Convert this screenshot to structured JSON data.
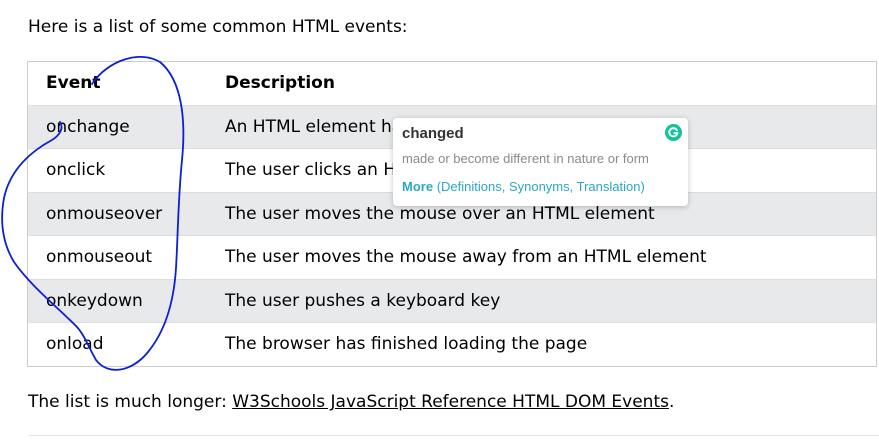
{
  "intro_text": "Here is a list of some common HTML events:",
  "table": {
    "headers": [
      "Event",
      "Description"
    ],
    "rows": [
      {
        "event": "onchange",
        "description": "An HTML element has been changed"
      },
      {
        "event": "onclick",
        "description": "The user clicks an HTML element"
      },
      {
        "event": "onmouseover",
        "description": "The user moves the mouse over an HTML element"
      },
      {
        "event": "onmouseout",
        "description": "The user moves the mouse away from an HTML element"
      },
      {
        "event": "onkeydown",
        "description": "The user pushes a keyboard key"
      },
      {
        "event": "onload",
        "description": "The browser has finished loading the page"
      }
    ]
  },
  "outro": {
    "prefix": "The list is much longer: ",
    "link_text": "W3Schools JavaScript Reference HTML DOM Events",
    "suffix": "."
  },
  "popup": {
    "word": "changed",
    "definition": "made or become different in nature or form",
    "more_label": "More",
    "more_links": "(Definitions, Synonyms, Translation)",
    "icon": "grammarly-icon",
    "icon_color": "#15c39a",
    "link_color": "#2aa7c5"
  },
  "colors": {
    "row_stripe": "#e7e9eb",
    "annotation_stroke": "#0b1fd6"
  }
}
